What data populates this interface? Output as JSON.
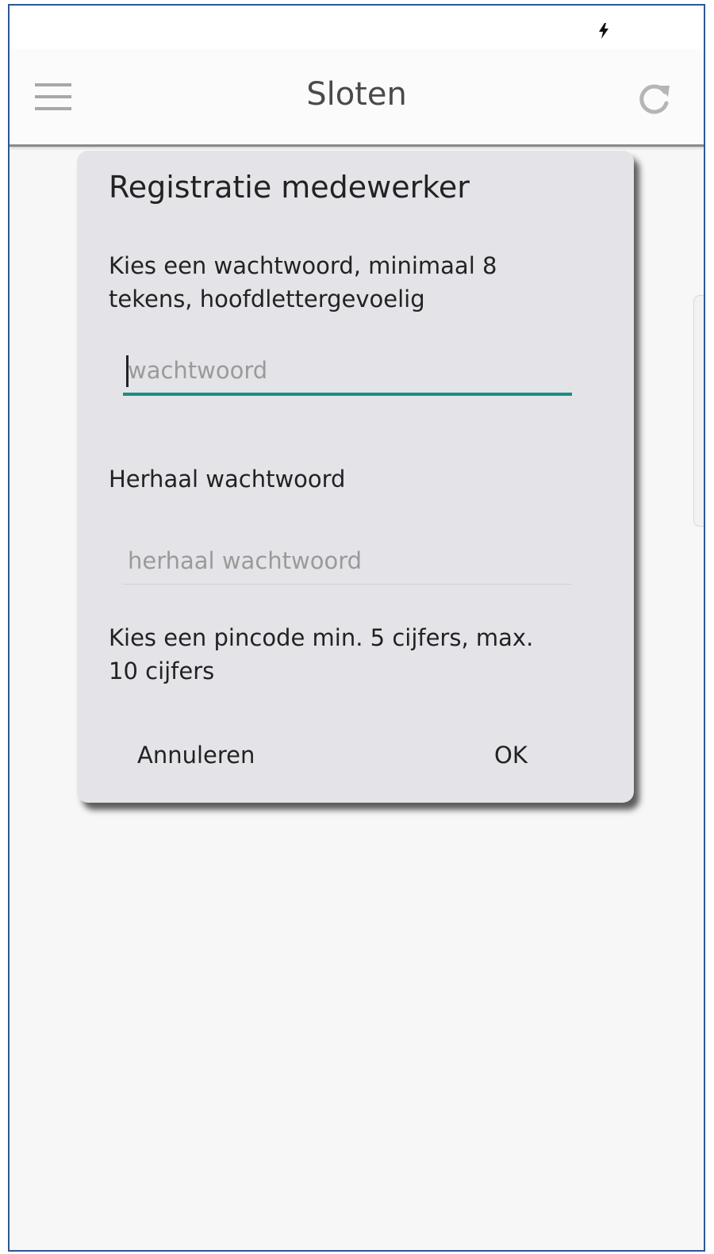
{
  "app_bar": {
    "title": "Sloten"
  },
  "icons": {
    "status": "charging-icon",
    "menu": "hamburger-menu-icon",
    "refresh": "refresh-icon"
  },
  "dialog": {
    "title": "Registratie medewerker",
    "password_instruction": "Kies een wachtwoord, minimaal 8 tekens, hoofdlettergevoelig",
    "password_input": {
      "placeholder": "wachtwoord",
      "value": ""
    },
    "repeat_label": "Herhaal wachtwoord",
    "repeat_input": {
      "placeholder": "herhaal wachtwoord",
      "value": ""
    },
    "pin_instruction": "Kies een pincode min. 5 cijfers, max. 10 cijfers",
    "cancel_label": "Annuleren",
    "ok_label": "OK"
  },
  "colors": {
    "accent": "#1a8c86",
    "dialog_background": "#e4e4e8",
    "frame_border": "#2f5597"
  }
}
